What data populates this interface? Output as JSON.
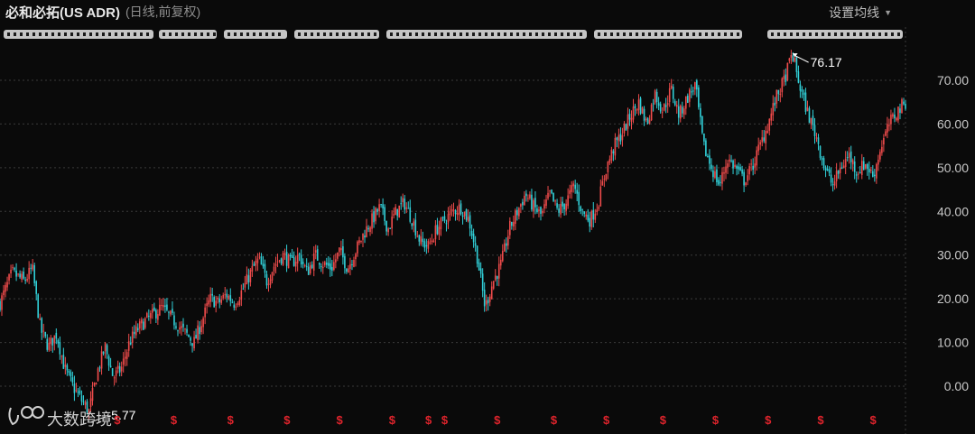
{
  "header": {
    "title": "必和必拓(US ADR)",
    "subtitle": "(日线,前复权)",
    "settings_label": "设置均线",
    "settings_icon": "caret-down-icon"
  },
  "logo": {
    "icon": "futu-bull-logo-icon",
    "text": "大数跨境"
  },
  "colors": {
    "background": "#0a0a0a",
    "up": "#ef4b4b",
    "down": "#31d0d8",
    "grid": "#3a3a3a",
    "dividend": "#e0242c"
  },
  "chart_data": {
    "type": "candlestick",
    "title": "必和必拓(US ADR)",
    "subtitle": "(日线,前复权)",
    "yaxis_ticks": [
      "70.00",
      "60.00",
      "50.00",
      "40.00",
      "30.00",
      "20.00",
      "10.00",
      "0.00"
    ],
    "ylim": [
      -7,
      79
    ],
    "grid": "horizontal dashed",
    "y_axis_position": "right",
    "series_points": [
      [
        0,
        19
      ],
      [
        1.5,
        26
      ],
      [
        3,
        24
      ],
      [
        4,
        27
      ],
      [
        5,
        13
      ],
      [
        6,
        9
      ],
      [
        7,
        12
      ],
      [
        8,
        4
      ],
      [
        9,
        0
      ],
      [
        10,
        -3
      ],
      [
        11,
        -5.77
      ],
      [
        12,
        3
      ],
      [
        13,
        9
      ],
      [
        14,
        2
      ],
      [
        15,
        4
      ],
      [
        16,
        10
      ],
      [
        17,
        13
      ],
      [
        18,
        15
      ],
      [
        20,
        18
      ],
      [
        22,
        14
      ],
      [
        23,
        12
      ],
      [
        24,
        10
      ],
      [
        25,
        15
      ],
      [
        26,
        20
      ],
      [
        27,
        19
      ],
      [
        28,
        21
      ],
      [
        29,
        19
      ],
      [
        30,
        22
      ],
      [
        31,
        26
      ],
      [
        32,
        29
      ],
      [
        33,
        24
      ],
      [
        34,
        28
      ],
      [
        35,
        30
      ],
      [
        36,
        28
      ],
      [
        37,
        30
      ],
      [
        38,
        26
      ],
      [
        39,
        30
      ],
      [
        40,
        28
      ],
      [
        41,
        27
      ],
      [
        42,
        31
      ],
      [
        43,
        27
      ],
      [
        44,
        31
      ],
      [
        45,
        35
      ],
      [
        46,
        38
      ],
      [
        47,
        41
      ],
      [
        48,
        36
      ],
      [
        49,
        40
      ],
      [
        50,
        42
      ],
      [
        51,
        38
      ],
      [
        52,
        33
      ],
      [
        53,
        32
      ],
      [
        54,
        36
      ],
      [
        55,
        38
      ],
      [
        56,
        40
      ],
      [
        57,
        41
      ],
      [
        58,
        38
      ],
      [
        59,
        30
      ],
      [
        60,
        18
      ],
      [
        61,
        24
      ],
      [
        62,
        28
      ],
      [
        63,
        36
      ],
      [
        64,
        40
      ],
      [
        65,
        44
      ],
      [
        66,
        41
      ],
      [
        67,
        39
      ],
      [
        68,
        44
      ],
      [
        69,
        40
      ],
      [
        70,
        42
      ],
      [
        71,
        46
      ],
      [
        72,
        40
      ],
      [
        73,
        38
      ],
      [
        74,
        42
      ],
      [
        75,
        50
      ],
      [
        76,
        55
      ],
      [
        77,
        58
      ],
      [
        78,
        62
      ],
      [
        79,
        65
      ],
      [
        80,
        60
      ],
      [
        81,
        67
      ],
      [
        82,
        63
      ],
      [
        83,
        68
      ],
      [
        84,
        62
      ],
      [
        85,
        66
      ],
      [
        86,
        69
      ],
      [
        87,
        55
      ],
      [
        88,
        50
      ],
      [
        89,
        46
      ],
      [
        90,
        52
      ],
      [
        91,
        50
      ],
      [
        92,
        47
      ],
      [
        93,
        50
      ],
      [
        94,
        55
      ],
      [
        95,
        60
      ],
      [
        96,
        66
      ],
      [
        97,
        70
      ],
      [
        98,
        76.17
      ],
      [
        99,
        68
      ],
      [
        100,
        62
      ],
      [
        101,
        57
      ],
      [
        102,
        50
      ],
      [
        103,
        46
      ],
      [
        104,
        50
      ],
      [
        105,
        53
      ],
      [
        106,
        49
      ],
      [
        107,
        51
      ],
      [
        108,
        48
      ],
      [
        109,
        55
      ],
      [
        110,
        60
      ],
      [
        111,
        63
      ],
      [
        112,
        65
      ]
    ],
    "x_range": [
      0,
      112
    ],
    "annotations": [
      {
        "label": "76.17",
        "value": 76.17,
        "type": "high"
      },
      {
        "label": "-5.77",
        "value": -5.77,
        "type": "low"
      }
    ],
    "dividend_markers": [
      {
        "label": "$",
        "x": 14.5
      },
      {
        "label": "$",
        "x": 21.5
      },
      {
        "label": "$",
        "x": 28.5
      },
      {
        "label": "$",
        "x": 35.5
      },
      {
        "label": "$",
        "x": 42
      },
      {
        "label": "$",
        "x": 48.5
      },
      {
        "label": "$",
        "x": 53
      },
      {
        "label": "$",
        "x": 55
      },
      {
        "label": "$",
        "x": 61.5
      },
      {
        "label": "$",
        "x": 68.5
      },
      {
        "label": "$",
        "x": 75
      },
      {
        "label": "$",
        "x": 82
      },
      {
        "label": "$",
        "x": 88.5
      },
      {
        "label": "$",
        "x": 95
      },
      {
        "label": "$",
        "x": 101.5
      },
      {
        "label": "$",
        "x": 108
      }
    ]
  }
}
